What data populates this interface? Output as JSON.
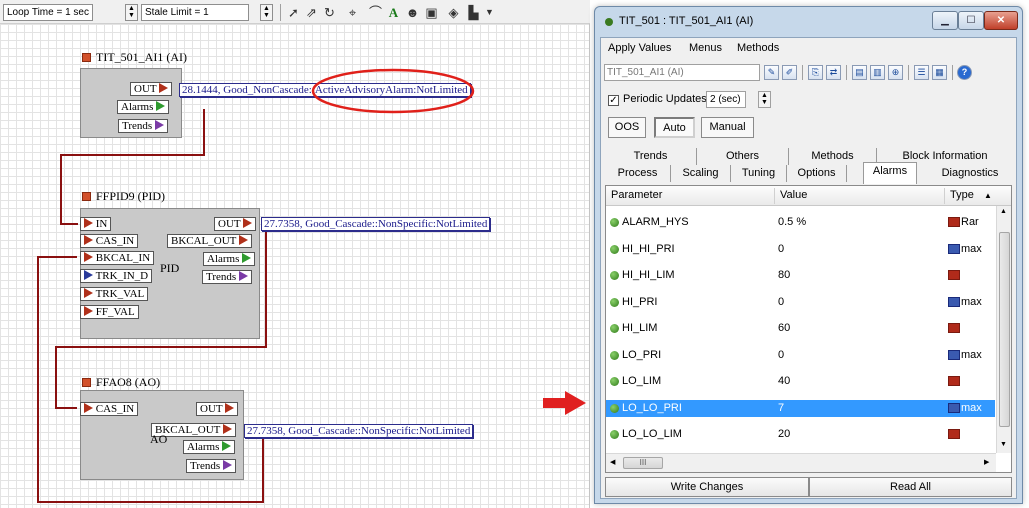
{
  "toolbar": {
    "loop_time": "Loop Time = 1 sec",
    "stale_limit": "Stale Limit = 1"
  },
  "canvas": {
    "ai_block": {
      "title": "TIT_501_AI1 (AI)",
      "out": "OUT",
      "alarms": "Alarms",
      "trends": "Trends",
      "status": "28.1444, Good_NonCascade::ActiveAdvisoryAlarm:NotLimited"
    },
    "pid_block": {
      "title": "FFPID9 (PID)",
      "in": "IN",
      "cas_in": "CAS_IN",
      "bkcal_in": "BKCAL_IN",
      "trk_in_d": "TRK_IN_D",
      "trk_val": "TRK_VAL",
      "ff_val": "FF_VAL",
      "out": "OUT",
      "bkcal_out": "BKCAL_OUT",
      "alarms": "Alarms",
      "trends": "Trends",
      "center": "PID",
      "status": "27.7358, Good_Cascade::NonSpecific:NotLimited"
    },
    "ao_block": {
      "title": "FFAO8 (AO)",
      "cas_in": "CAS_IN",
      "out": "OUT",
      "bkcal_out": "BKCAL_OUT",
      "alarms": "Alarms",
      "trends": "Trends",
      "center": "AO",
      "status": "27.7358, Good_Cascade::NonSpecific:NotLimited"
    },
    "highlight_color": "#e0201a",
    "arrow_color": "#e02020"
  },
  "dialog": {
    "title": "TIT_501 : TIT_501_AI1 (AI)",
    "menu": [
      "Apply Values",
      "Menus",
      "Methods"
    ],
    "block_name": "TIT_501_AI1 (AI)",
    "periodic_updates_label": "Periodic Updates",
    "periodic_checked": true,
    "interval": "2 (sec)",
    "modes": [
      "OOS",
      "Auto",
      "Manual"
    ],
    "active_mode": "Auto",
    "tabs_row1": [
      "Trends",
      "Others",
      "Methods",
      "Block Information"
    ],
    "tabs_row2": [
      "Process",
      "Scaling",
      "Tuning",
      "Options",
      "Alarms",
      "Diagnostics"
    ],
    "active_tab": "Alarms",
    "columns": [
      "Parameter",
      "Value",
      "Type"
    ],
    "rows": [
      {
        "name": "ALARM_HYS",
        "value": "0.5 %",
        "type": "Rar",
        "icon": "red"
      },
      {
        "name": "HI_HI_PRI",
        "value": "0",
        "type": "max",
        "icon": "blue"
      },
      {
        "name": "HI_HI_LIM",
        "value": "80",
        "type": "",
        "icon": "red"
      },
      {
        "name": "HI_PRI",
        "value": "0",
        "type": "max",
        "icon": "blue"
      },
      {
        "name": "HI_LIM",
        "value": "60",
        "type": "",
        "icon": "red"
      },
      {
        "name": "LO_PRI",
        "value": "0",
        "type": "max",
        "icon": "blue"
      },
      {
        "name": "LO_LIM",
        "value": "40",
        "type": "",
        "icon": "red"
      },
      {
        "name": "LO_LO_PRI",
        "value": "7",
        "type": "max",
        "icon": "blue"
      },
      {
        "name": "LO_LO_LIM",
        "value": "20",
        "type": "",
        "icon": "red"
      }
    ],
    "selected_row": "LO_LO_PRI",
    "hscroll_thumb": "III",
    "write_button": "Write Changes",
    "read_button": "Read All"
  }
}
